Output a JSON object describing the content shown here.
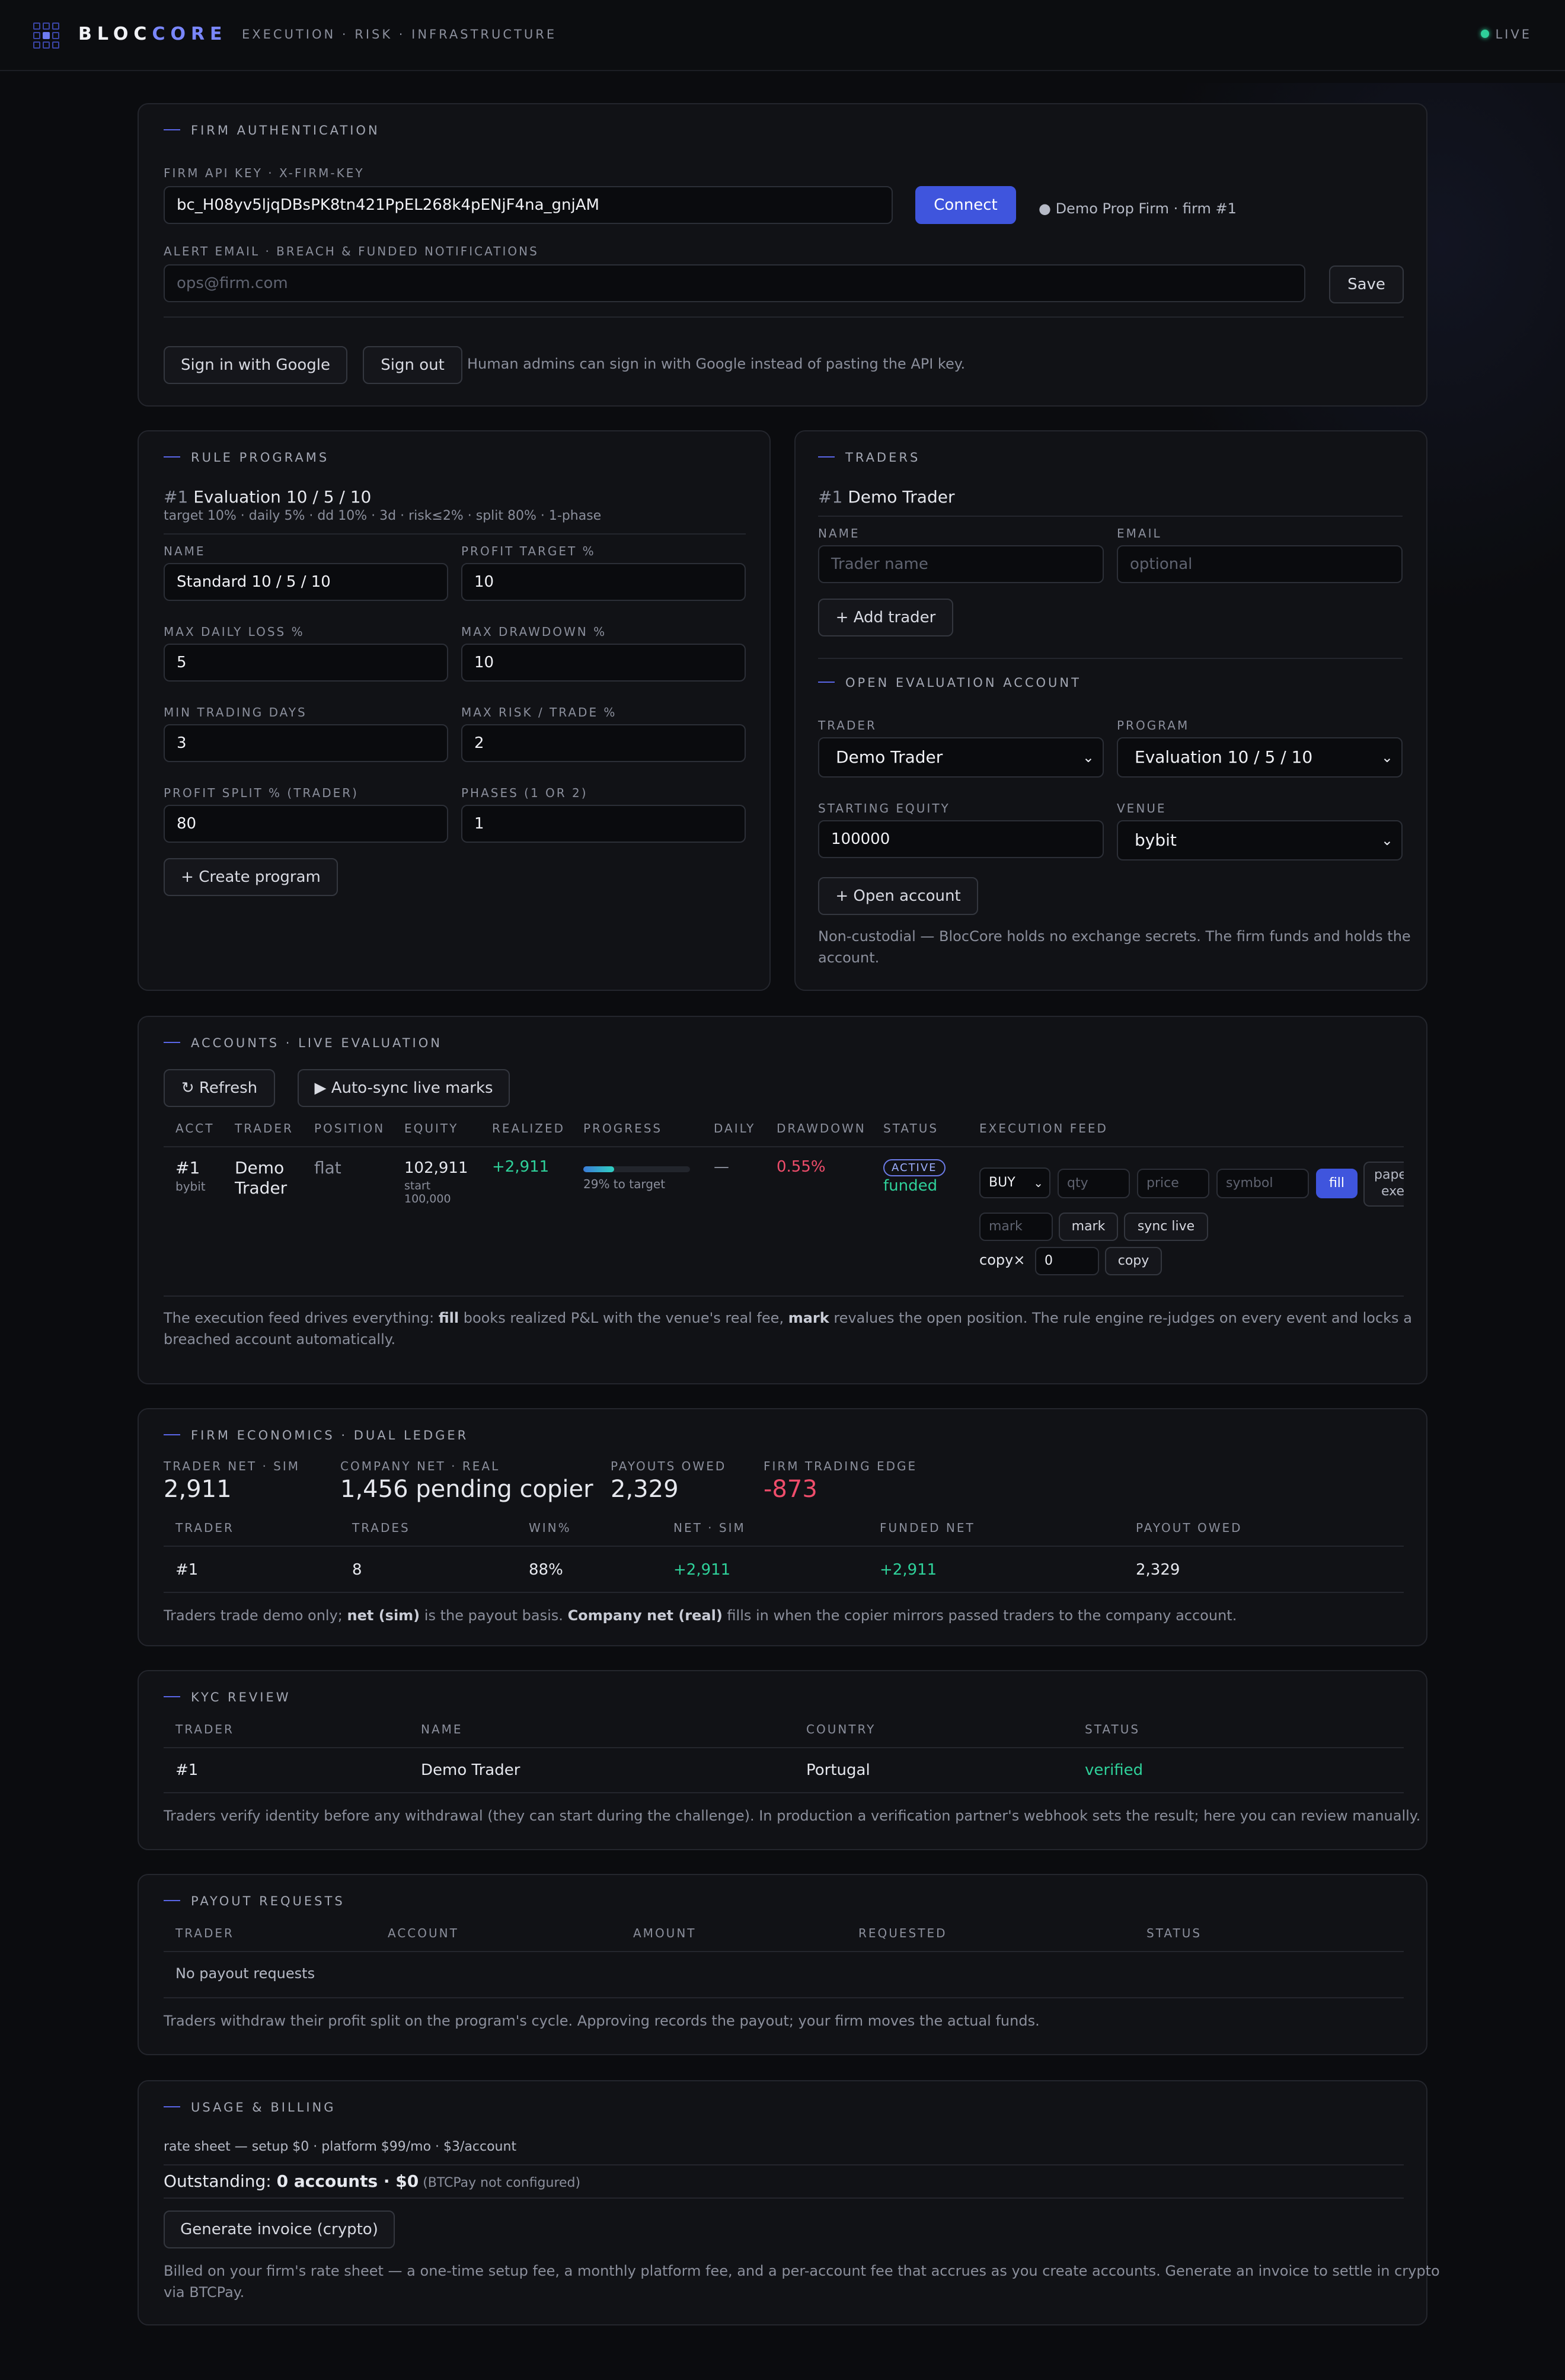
{
  "brand": {
    "part1": "BLOC",
    "part2": "CORE",
    "tagline": "EXECUTION · RISK · INFRASTRUCTURE",
    "live": "LIVE"
  },
  "auth": {
    "title": "FIRM AUTHENTICATION",
    "api_label": "FIRM API KEY · X-FIRM-KEY",
    "api_value": "bc_H08yv5ljqDBsPK8tn421PpEL268k4pENjF4na_gnjAM",
    "connect": "Connect",
    "firm_status": "● Demo Prop Firm · firm #1",
    "email_label": "ALERT EMAIL · BREACH & FUNDED NOTIFICATIONS",
    "email_placeholder": "ops@firm.com",
    "save": "Save",
    "google": "Sign in with Google",
    "signout": "Sign out",
    "hint": "Human admins can sign in with Google instead of pasting the API key."
  },
  "rules": {
    "title": "RULE PROGRAMS",
    "prog_num": "#1",
    "prog_name": "Evaluation 10 / 5 / 10",
    "prog_desc": "target 10% · daily 5% · dd 10% · 3d · risk≤2% · split 80% · 1-phase",
    "f": [
      {
        "label": "NAME",
        "value": "Standard 10 / 5 / 10"
      },
      {
        "label": "PROFIT TARGET %",
        "value": "10"
      },
      {
        "label": "MAX DAILY LOSS %",
        "value": "5"
      },
      {
        "label": "MAX DRAWDOWN %",
        "value": "10"
      },
      {
        "label": "MIN TRADING DAYS",
        "value": "3"
      },
      {
        "label": "MAX RISK / TRADE %",
        "value": "2"
      },
      {
        "label": "PROFIT SPLIT % (TRADER)",
        "value": "80"
      },
      {
        "label": "PHASES (1 OR 2)",
        "value": "1"
      }
    ],
    "create": "+ Create program"
  },
  "traders": {
    "title": "TRADERS",
    "t_num": "#1",
    "t_name": "Demo Trader",
    "name_label": "NAME",
    "name_ph": "Trader name",
    "email_label": "EMAIL",
    "email_ph": "optional",
    "add": "+ Add trader",
    "open_title": "OPEN EVALUATION ACCOUNT",
    "trader_label": "TRADER",
    "trader_val": "Demo Trader",
    "program_label": "PROGRAM",
    "program_val": "Evaluation 10 / 5 / 10",
    "equity_label": "STARTING EQUITY",
    "equity_val": "100000",
    "venue_label": "VENUE",
    "venue_val": "bybit",
    "open": "+ Open account",
    "note1": "Non-custodial — BlocCore holds no exchange secrets. The firm funds and holds the",
    "note2": "account."
  },
  "accounts": {
    "title": "ACCOUNTS · LIVE EVALUATION",
    "refresh": "↻ Refresh",
    "autosync": "▶ Auto-sync live marks",
    "cols": [
      "ACCT",
      "TRADER",
      "POSITION",
      "EQUITY",
      "REALIZED",
      "PROGRESS",
      "DAILY",
      "DRAWDOWN",
      "STATUS",
      "EXECUTION FEED"
    ],
    "row": {
      "acct": "#1",
      "venue": "bybit",
      "trader1": "Demo",
      "trader2": "Trader",
      "position": "flat",
      "equity": "102,911",
      "start1": "start",
      "start2": "100,000",
      "realized": "+2,911",
      "progress_label": "29% to target",
      "progress_fraction": 0.29,
      "daily": "—",
      "drawdown": "0.55%",
      "badge": "ACTIVE",
      "status": "funded"
    },
    "feed": {
      "side": "BUY",
      "qty_ph": "qty",
      "price_ph": "price",
      "symbol_ph": "symbol",
      "fill": "fill",
      "paper1": "pape",
      "paper2": "exec",
      "mark_ph": "mark",
      "mark": "mark",
      "sync": "sync live",
      "copy_label": "copy×",
      "copy_val": "0",
      "copy": "copy"
    },
    "note_a": "The execution feed drives everything: ",
    "note_fill": "fill",
    "note_b": " books realized P&L with the venue's real fee, ",
    "note_mark": "mark",
    "note_c": " revalues the open position. The rule engine re-judges on every event and locks a",
    "note_d": "breached account automatically."
  },
  "econ": {
    "title": "FIRM ECONOMICS · DUAL LEDGER",
    "stats": [
      {
        "label": "TRADER NET · SIM",
        "value": "2,911"
      },
      {
        "label": "COMPANY NET · REAL",
        "value": "1,456 pending copier"
      },
      {
        "label": "PAYOUTS OWED",
        "value": "2,329"
      },
      {
        "label": "FIRM TRADING EDGE",
        "value": "-873"
      }
    ],
    "cols": [
      "TRADER",
      "TRADES",
      "WIN%",
      "NET · SIM",
      "FUNDED NET",
      "PAYOUT OWED"
    ],
    "row": [
      "#1",
      "8",
      "88%",
      "+2,911",
      "+2,911",
      "2,329"
    ],
    "note_a": "Traders trade demo only; ",
    "note_b": "net (sim)",
    "note_c": " is the payout basis. ",
    "note_d": "Company net (real)",
    "note_e": " fills in when the copier mirrors passed traders to the company account."
  },
  "kyc": {
    "title": "KYC REVIEW",
    "cols": [
      "TRADER",
      "NAME",
      "COUNTRY",
      "STATUS"
    ],
    "row": [
      "#1",
      "Demo Trader",
      "Portugal",
      "verified"
    ],
    "note": "Traders verify identity before any withdrawal (they can start during the challenge). In production a verification partner's webhook sets the result; here you can review manually."
  },
  "payouts": {
    "title": "PAYOUT REQUESTS",
    "cols": [
      "TRADER",
      "ACCOUNT",
      "AMOUNT",
      "REQUESTED",
      "STATUS"
    ],
    "empty": "No payout requests",
    "note": "Traders withdraw their profit split on the program's cycle. Approving records the payout; your firm moves the actual funds."
  },
  "billing": {
    "title": "USAGE & BILLING",
    "rate": "rate sheet — setup $0 · platform $99/mo · $3/account",
    "out_a": "Outstanding: ",
    "out_b": "0 accounts · $0",
    "out_c": " (BTCPay not configured)",
    "invoice": "Generate invoice (crypto)",
    "note1": "Billed on your firm's rate sheet — a one-time setup fee, a monthly platform fee, and a per-account fee that accrues as you create accounts. Generate an invoice to settle in crypto",
    "note2": "via BTCPay."
  },
  "colors": {
    "accent": "#3f55dd",
    "green": "#2fd19a",
    "red": "#ef4d6b",
    "bg": "#0b0c0f"
  }
}
